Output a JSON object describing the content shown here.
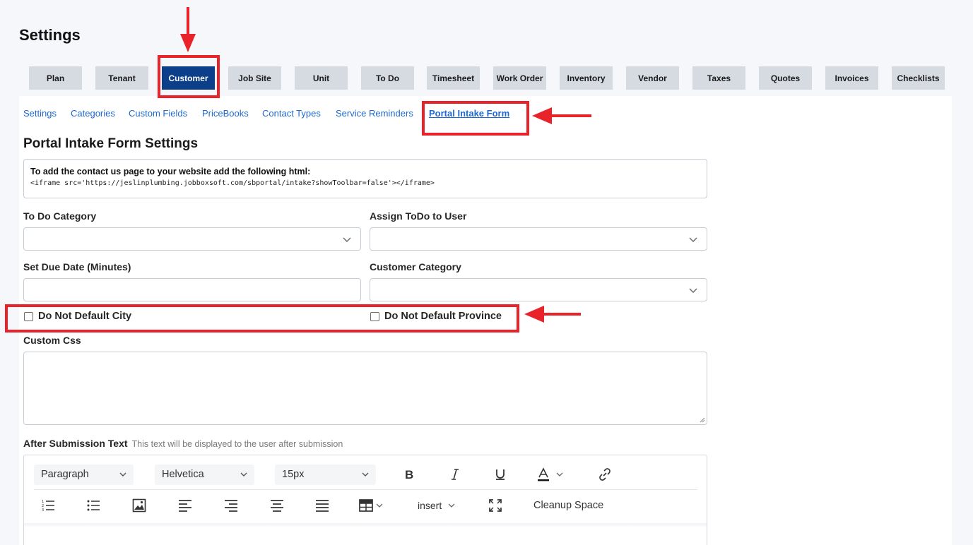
{
  "page": {
    "title": "Settings"
  },
  "tabs": [
    {
      "label": "Plan",
      "active": false
    },
    {
      "label": "Tenant",
      "active": false
    },
    {
      "label": "Customer",
      "active": true
    },
    {
      "label": "Job Site",
      "active": false
    },
    {
      "label": "Unit",
      "active": false
    },
    {
      "label": "To Do",
      "active": false
    },
    {
      "label": "Timesheet",
      "active": false
    },
    {
      "label": "Work Order",
      "active": false
    },
    {
      "label": "Inventory",
      "active": false
    },
    {
      "label": "Vendor",
      "active": false
    },
    {
      "label": "Taxes",
      "active": false
    },
    {
      "label": "Quotes",
      "active": false
    },
    {
      "label": "Invoices",
      "active": false
    },
    {
      "label": "Checklists",
      "active": false
    }
  ],
  "subnav": [
    {
      "label": "Settings",
      "active": false
    },
    {
      "label": "Categories",
      "active": false
    },
    {
      "label": "Custom Fields",
      "active": false
    },
    {
      "label": "PriceBooks",
      "active": false
    },
    {
      "label": "Contact Types",
      "active": false
    },
    {
      "label": "Service Reminders",
      "active": false
    },
    {
      "label": "Portal Intake Form",
      "active": true
    }
  ],
  "form": {
    "title": "Portal Intake Form Settings",
    "embed_hint": "To add the contact us page to your website add the following html:",
    "embed_code": "<iframe src='https://jeslinplumbing.jobboxsoft.com/sbportal/intake?showToolbar=false'></iframe>",
    "todo_category": {
      "label": "To Do Category",
      "value": ""
    },
    "assign_todo_user": {
      "label": "Assign ToDo to User",
      "value": ""
    },
    "due_date": {
      "label": "Set Due Date (Minutes)",
      "value": ""
    },
    "customer_category": {
      "label": "Customer Category",
      "value": ""
    },
    "no_default_city": {
      "label": "Do Not Default City",
      "checked": false
    },
    "no_default_province": {
      "label": "Do Not Default Province",
      "checked": false
    },
    "custom_css": {
      "label": "Custom Css",
      "value": ""
    },
    "after_submission": {
      "label": "After Submission Text",
      "note": "This text will be displayed to the user after submission"
    }
  },
  "editor": {
    "block_format": "Paragraph",
    "font_family": "Helvetica",
    "font_size": "15px",
    "insert_label": "insert",
    "cleanup_label": "Cleanup Space",
    "icons": [
      "bold-icon",
      "italic-icon",
      "underline-icon",
      "font-color-icon",
      "link-icon",
      "ordered-list-icon",
      "unordered-list-icon",
      "image-icon",
      "align-left-icon",
      "align-right-icon",
      "align-center-icon",
      "align-justify-icon",
      "table-icon",
      "fullscreen-icon"
    ]
  },
  "annotations": {
    "color": "#e8232a"
  }
}
